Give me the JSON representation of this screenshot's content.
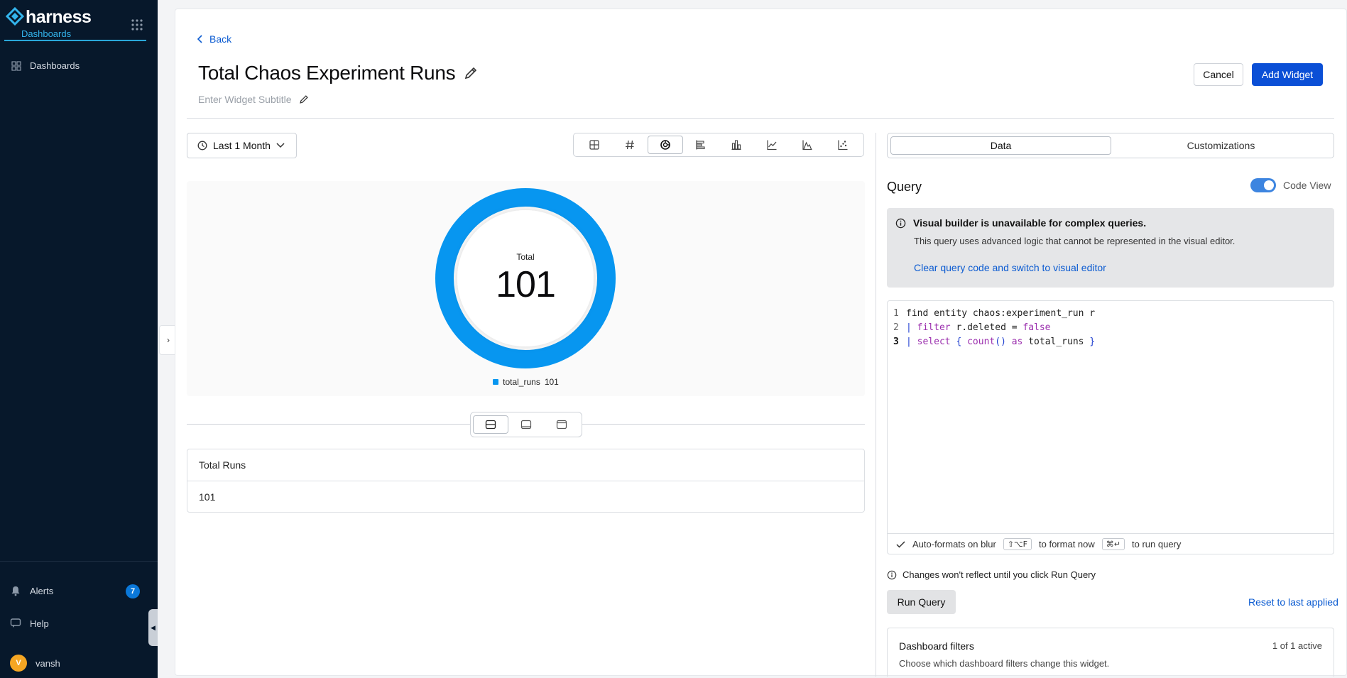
{
  "sidebar": {
    "brand_name": "harness",
    "brand_sub": "Dashboards",
    "nav_dashboards": "Dashboards",
    "alerts_label": "Alerts",
    "alerts_count": "7",
    "help_label": "Help",
    "user_initial": "V",
    "user_name": "vansh"
  },
  "header": {
    "back_label": "Back",
    "title": "Total Chaos Experiment Runs",
    "subtitle_placeholder": "Enter Widget Subtitle",
    "cancel_label": "Cancel",
    "add_label": "Add Widget"
  },
  "toolbar": {
    "time_range": "Last 1 Month",
    "viz_types": [
      "table-icon",
      "number-icon",
      "donut-icon",
      "horizontal-bar-icon",
      "bar-icon",
      "line-icon",
      "area-icon",
      "scatter-icon"
    ],
    "active_viz": "donut-icon"
  },
  "chart_data": {
    "type": "pie",
    "center_label": "Total",
    "center_value": "101",
    "series": [
      {
        "name": "total_runs",
        "values": [
          101
        ]
      }
    ],
    "legend_label": "total_runs",
    "legend_value": "101",
    "colors": [
      "#0796f0"
    ]
  },
  "layout_toggle": [
    "split-layout-icon",
    "chart-only-icon",
    "table-only-icon"
  ],
  "table": {
    "header": "Total Runs",
    "value": "101"
  },
  "tabs": {
    "data": "Data",
    "customizations": "Customizations"
  },
  "query": {
    "title": "Query",
    "code_view_label": "Code View",
    "info_title": "Visual builder is unavailable for complex queries.",
    "info_body": "This query uses advanced logic that cannot be represented in the visual editor.",
    "info_link": "Clear query code and switch to visual editor",
    "lines": {
      "l1_num": "1",
      "l1_text": "find entity chaos:experiment_run r",
      "l2_num": "2",
      "l2_pipe": "| ",
      "l2_kw": "filter",
      "l2_mid": " r.deleted = ",
      "l2_val": "false",
      "l3_num": "3",
      "l3_pipe": "| ",
      "l3_kw": "select",
      "l3_open": " { ",
      "l3_fn": "count",
      "l3_paren": "()",
      "l3_as": " as ",
      "l3_field": "total_runs",
      "l3_close": " }"
    },
    "footer_autofmt": "Auto-formats on blur",
    "footer_kbd_format": "⇧⌥F",
    "footer_format_text": "to format now",
    "footer_kbd_run": "⌘↵",
    "footer_run_text": "to run query",
    "notice": "Changes won't reflect until you click Run Query",
    "run_label": "Run Query",
    "reset_label": "Reset to last applied"
  },
  "filters": {
    "title": "Dashboard filters",
    "count": "1 of 1 active",
    "desc": "Choose which dashboard filters change this widget."
  },
  "colors": {
    "sidebar_bg": "#07182b",
    "accent": "#0b4fd6",
    "link": "#0b5bd1",
    "donut": "#0796f0"
  }
}
